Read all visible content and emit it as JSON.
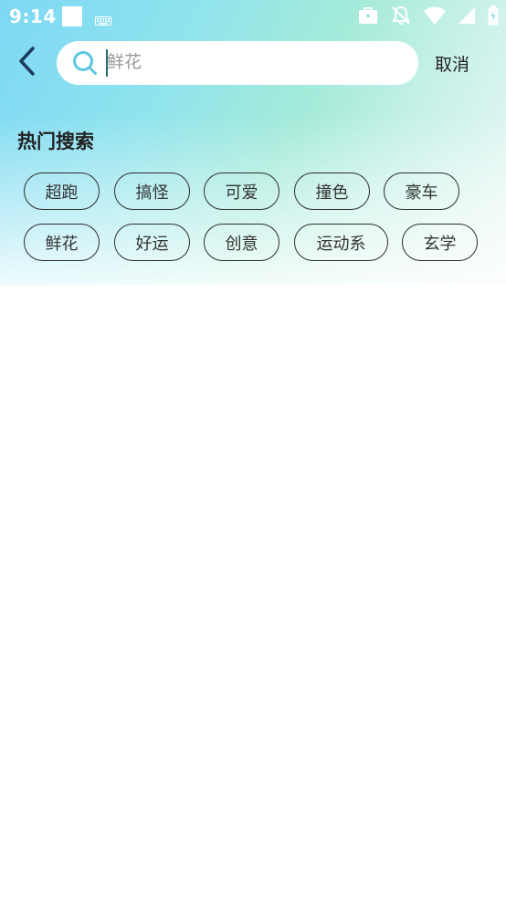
{
  "status_bar": {
    "time": "9:14",
    "icons": [
      "notification-square-icon",
      "keyboard-icon",
      "briefcase-icon",
      "bell-off-icon",
      "wifi-icon",
      "signal-icon",
      "battery-icon"
    ]
  },
  "search": {
    "value": "",
    "placeholder": "鲜花",
    "cancel_label": "取消"
  },
  "hot_search": {
    "title": "热门搜索",
    "tags": [
      "超跑",
      "搞怪",
      "可爱",
      "撞色",
      "豪车",
      "鲜花",
      "好运",
      "创意",
      "运动系",
      "玄学"
    ]
  },
  "colors": {
    "accent_teal": "#1f6f6a",
    "search_icon": "#5cc8e0",
    "back_arrow": "#1e3a5f"
  }
}
